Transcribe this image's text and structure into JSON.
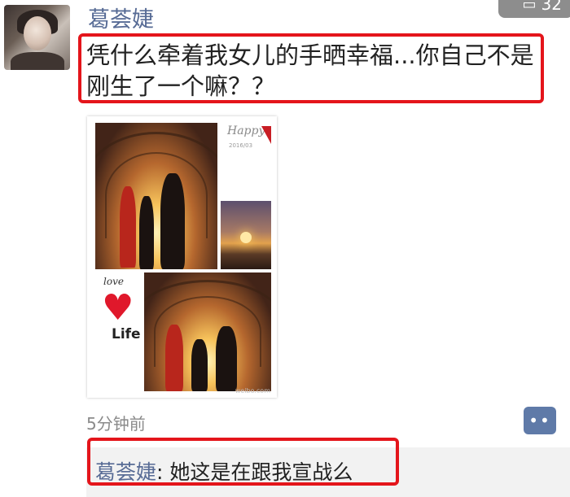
{
  "post": {
    "username": "葛荟婕",
    "text": "凭什么牵着我女儿的手晒幸福...你自己不是刚生了一个嘛？？",
    "time": "5分钟前",
    "badge_count": "32",
    "photo_collage": {
      "happy_text": "Happy",
      "happy_date": "2016/03",
      "love_text": "love",
      "life_text": "Life",
      "watermark": "weibo.com"
    }
  },
  "comment": {
    "author": "葛荟婕",
    "separator": ": ",
    "text": "她这是在跟我宣战么"
  },
  "icons": {
    "comment": "comment-dots-icon",
    "badge": "bookmark-icon",
    "heart": "heart-icon"
  },
  "colors": {
    "username": "#576b95",
    "highlight_border": "#e4151b",
    "comment_button": "#5f7aa8",
    "comment_background": "#f2f2f2"
  }
}
